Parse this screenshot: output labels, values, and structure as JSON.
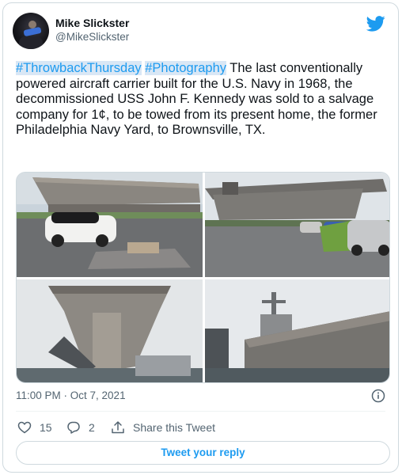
{
  "tweet": {
    "author_name": "Mike Slickster",
    "author_handle": "@MikeSlickster",
    "hashtag1": "#ThrowbackThursday",
    "hashtag2": "#Photography",
    "body": "The last conventionally powered aircraft carrier built for the U.S. Navy in 1968, the decommissioned USS John F. Kennedy was sold to a salvage company for 1¢, to be towed from its present home, the former Philadelphia Navy Yard, to Brownsville, TX.",
    "timestamp": "11:00 PM · Oct 7, 2021"
  },
  "actions": {
    "likes": "15",
    "replies": "2",
    "share_label": "Share this Tweet"
  },
  "reply_button": "Tweet your reply",
  "icons": {
    "brand": "twitter-bird-icon",
    "like": "heart-icon",
    "reply": "speech-bubble-icon",
    "share": "share-upload-icon",
    "info": "info-icon"
  },
  "colors": {
    "accent": "#1d9bf0",
    "text": "#0f1419",
    "muted": "#536471",
    "border": "#cfd9de"
  }
}
